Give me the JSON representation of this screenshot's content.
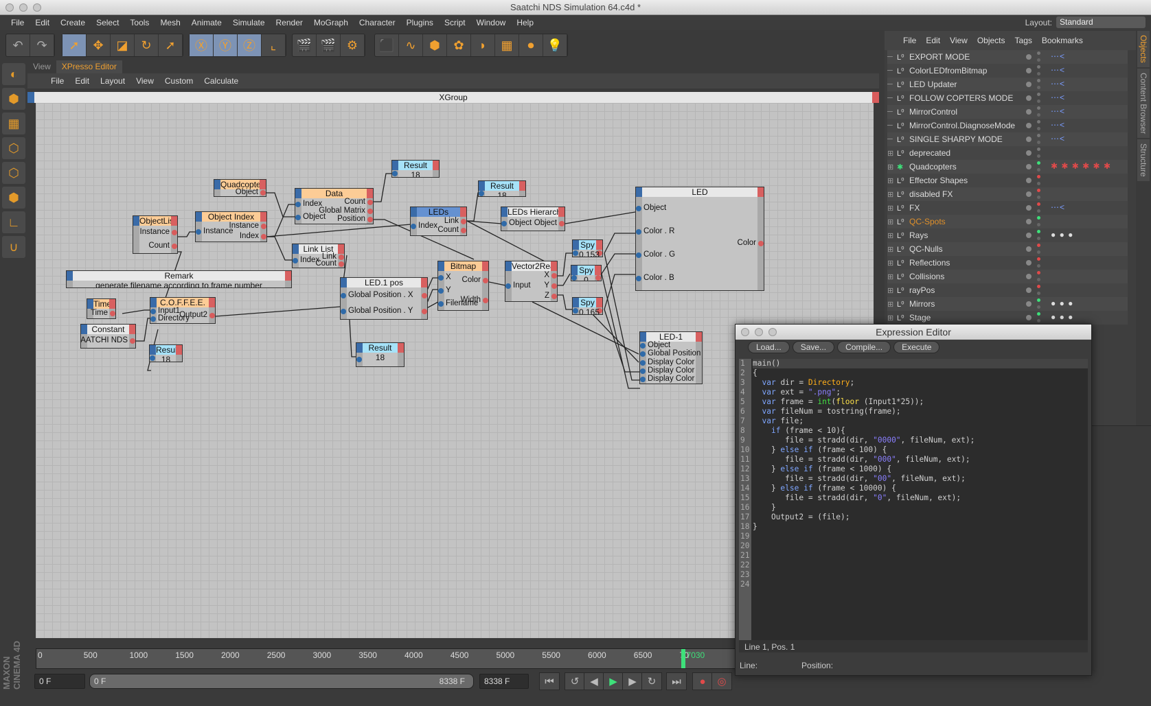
{
  "window": {
    "title": "Saatchi NDS Simulation 64.c4d *"
  },
  "menu": [
    "File",
    "Edit",
    "Create",
    "Select",
    "Tools",
    "Mesh",
    "Animate",
    "Simulate",
    "Render",
    "MoGraph",
    "Character",
    "Plugins",
    "Script",
    "Window",
    "Help"
  ],
  "layout": {
    "label": "Layout:",
    "value": "Standard"
  },
  "toolbar_icons": [
    "undo-icon",
    "redo-icon",
    "live-select-icon",
    "move-icon",
    "scale-icon",
    "rotate-icon",
    "last-tool-icon",
    "x-axis-icon",
    "y-axis-icon",
    "z-axis-icon",
    "coordinate-system-icon",
    "render-view-icon",
    "render-picture-viewer-icon",
    "render-settings-icon",
    "cube-icon",
    "spline-icon",
    "nurbs-icon",
    "array-icon",
    "deformer-icon",
    "floor-icon",
    "camera-icon",
    "light-icon"
  ],
  "xpresso": {
    "tabs": [
      "View",
      "XPresso Editor"
    ],
    "menu": [
      "File",
      "Edit",
      "Layout",
      "View",
      "Custom",
      "Calculate"
    ],
    "group_title": "XGroup",
    "nodes": [
      {
        "title": "Result",
        "style": "res",
        "inputs": [
          ""
        ],
        "outputs": [],
        "value": "18"
      },
      {
        "title": "Quadcopters",
        "style": "obj",
        "inputs": [],
        "outputs": [
          "Object"
        ]
      },
      {
        "title": "Data",
        "style": "obj",
        "inputs": [
          "Index",
          "Object"
        ],
        "outputs": [
          "Count",
          "Global Matrix",
          "Position"
        ]
      },
      {
        "title": "ObjectList",
        "style": "obj",
        "inputs": [],
        "outputs": [
          "Instance",
          "Count"
        ]
      },
      {
        "title": "Object Index",
        "style": "obj",
        "inputs": [
          "Instance"
        ],
        "outputs": [
          "Instance",
          "Index"
        ]
      },
      {
        "title": "LEDs",
        "style": "blue",
        "inputs": [
          "Index"
        ],
        "outputs": [
          "Link",
          "Count"
        ]
      },
      {
        "title": "Result",
        "style": "res",
        "inputs": [
          ""
        ],
        "outputs": [],
        "value": "18"
      },
      {
        "title": "LEDs Hierarchy",
        "style": "gen",
        "inputs": [
          "Object"
        ],
        "outputs": [
          "Object"
        ]
      },
      {
        "title": "LED",
        "style": "gen",
        "inputs": [
          "Object",
          "Color . R",
          "Color . G",
          "Color . B"
        ],
        "outputs": [
          "Color"
        ]
      },
      {
        "title": "Link List",
        "style": "gen",
        "inputs": [
          "Index"
        ],
        "outputs": [
          "Link",
          "Count"
        ]
      },
      {
        "title": "Remark",
        "style": "gen",
        "inputs": [],
        "outputs": [],
        "value": "generate filename according to frame number"
      },
      {
        "title": "LED.1 pos",
        "style": "gen",
        "inputs": [
          "Global Position . X",
          "Global Position . Y"
        ],
        "outputs": [
          "",
          ""
        ]
      },
      {
        "title": "Bitmap",
        "style": "obj",
        "inputs": [
          "X",
          "Y",
          "Filename"
        ],
        "outputs": [
          "Color",
          "Width"
        ]
      },
      {
        "title": "Vector2Real",
        "style": "gen",
        "inputs": [
          "Input"
        ],
        "outputs": [
          "X",
          "Y",
          "Z"
        ]
      },
      {
        "title": "Spy",
        "style": "res",
        "inputs": [
          ""
        ],
        "outputs": [
          ""
        ],
        "value": "0.153"
      },
      {
        "title": "Spy",
        "style": "res",
        "inputs": [
          ""
        ],
        "outputs": [
          ""
        ],
        "value": "0"
      },
      {
        "title": "Spy",
        "style": "res",
        "inputs": [
          ""
        ],
        "outputs": [
          ""
        ],
        "value": "0.165"
      },
      {
        "title": "Time",
        "style": "obj",
        "inputs": [],
        "outputs": [
          "Time"
        ]
      },
      {
        "title": "C.O.F.F.E.E.",
        "style": "obj",
        "inputs": [
          "Input1",
          "Directory"
        ],
        "outputs": [
          "Output2"
        ]
      },
      {
        "title": "Constant",
        "style": "gen",
        "inputs": [],
        "outputs": [
          "SAATCHI NDS"
        ]
      },
      {
        "title": "Result",
        "style": "res",
        "inputs": [
          ""
        ],
        "outputs": [],
        "value": "18"
      },
      {
        "title": "Result",
        "style": "res",
        "inputs": [
          ""
        ],
        "outputs": [],
        "value": "18"
      },
      {
        "title": "LED-1",
        "style": "gen",
        "inputs": [
          "Object",
          "Global Position",
          "Display Color",
          "Display Color",
          "Display Color"
        ],
        "outputs": []
      }
    ]
  },
  "object_manager": {
    "menu": [
      "File",
      "Edit",
      "View",
      "Objects",
      "Tags",
      "Bookmarks"
    ],
    "rows": [
      {
        "name": "EXPORT MODE",
        "expand": false,
        "status": "gray",
        "tags": "xpresso"
      },
      {
        "name": "ColorLEDfromBitmap",
        "expand": false,
        "status": "gray",
        "tags": "xpresso"
      },
      {
        "name": "LED Updater",
        "expand": false,
        "status": "gray",
        "tags": "xpresso"
      },
      {
        "name": "FOLLOW COPTERS MODE",
        "expand": false,
        "status": "gray",
        "tags": "xpresso"
      },
      {
        "name": "MirrorControl",
        "expand": false,
        "status": "gray",
        "tags": "xpresso"
      },
      {
        "name": "MirrorControl.DiagnoseMode",
        "expand": false,
        "status": "gray",
        "tags": "xpresso"
      },
      {
        "name": "SINGLE SHARPY MODE",
        "expand": false,
        "status": "gray",
        "tags": "xpresso"
      },
      {
        "name": "deprecated",
        "expand": true,
        "status": "gray",
        "tags": ""
      },
      {
        "name": "Quadcopters",
        "expand": true,
        "status": "green",
        "tags": "cloner"
      },
      {
        "name": "Effector Shapes",
        "expand": true,
        "status": "red",
        "tags": ""
      },
      {
        "name": "disabled FX",
        "expand": true,
        "status": "red",
        "tags": ""
      },
      {
        "name": "FX",
        "expand": true,
        "status": "red",
        "tags": "xpresso"
      },
      {
        "name": "QC-Spots",
        "expand": true,
        "status": "green",
        "tags": "",
        "highlight": "#e0902a"
      },
      {
        "name": "Rays",
        "expand": true,
        "status": "green",
        "tags": "material"
      },
      {
        "name": "QC-Nulls",
        "expand": true,
        "status": "red",
        "tags": ""
      },
      {
        "name": "Reflections",
        "expand": true,
        "status": "red",
        "tags": ""
      },
      {
        "name": "Collisions",
        "expand": true,
        "status": "red",
        "tags": ""
      },
      {
        "name": "rayPos",
        "expand": true,
        "status": "red",
        "tags": ""
      },
      {
        "name": "Mirrors",
        "expand": true,
        "status": "green",
        "tags": "material"
      },
      {
        "name": "Stage",
        "expand": true,
        "status": "green",
        "tags": "material"
      }
    ],
    "side_tabs": [
      "Objects",
      "Content Browser",
      "Structure"
    ]
  },
  "timeline": {
    "ticks": [
      "0",
      "500",
      "1000",
      "1500",
      "2000",
      "2500",
      "3000",
      "3500",
      "4000",
      "4500",
      "5000",
      "5500",
      "6000",
      "6500",
      "70"
    ],
    "current_frame": "7030",
    "range_max": 8338,
    "start_field": "0 F",
    "slider_start": "0 F",
    "slider_end": "8338 F",
    "end_field": "8338 F"
  },
  "expression_editor": {
    "title": "Expression Editor",
    "buttons": [
      "Load...",
      "Save...",
      "Compile...",
      "Execute"
    ],
    "code": [
      [
        [
          "main()",
          "txt"
        ]
      ],
      [
        [
          "{",
          "txt"
        ]
      ],
      [
        [
          "  ",
          "txt"
        ],
        [
          "var",
          "kw"
        ],
        [
          " dir = ",
          "txt"
        ],
        [
          "Directory",
          "cls"
        ],
        [
          ";",
          "txt"
        ]
      ],
      [
        [
          "  ",
          "txt"
        ],
        [
          "var",
          "kw"
        ],
        [
          " ext = ",
          "txt"
        ],
        [
          "\".png\"",
          "str"
        ],
        [
          ";",
          "txt"
        ]
      ],
      [
        [
          "  ",
          "txt"
        ],
        [
          "var",
          "kw"
        ],
        [
          " frame = ",
          "txt"
        ],
        [
          "int",
          "int"
        ],
        [
          "(",
          "txt"
        ],
        [
          "floor",
          "fn"
        ],
        [
          " (Input1*25));",
          "txt"
        ]
      ],
      [
        [
          "  ",
          "txt"
        ],
        [
          "var",
          "kw"
        ],
        [
          " fileNum = tostring(frame);",
          "txt"
        ]
      ],
      [
        [
          "  ",
          "txt"
        ],
        [
          "var",
          "kw"
        ],
        [
          " file;",
          "txt"
        ]
      ],
      [
        [
          "",
          "txt"
        ]
      ],
      [
        [
          "    ",
          "txt"
        ],
        [
          "if",
          "kw"
        ],
        [
          " (frame < 10){",
          "txt"
        ]
      ],
      [
        [
          "       file = stradd(dir, ",
          "txt"
        ],
        [
          "\"0000\"",
          "str"
        ],
        [
          ", fileNum, ext);",
          "txt"
        ]
      ],
      [
        [
          "",
          "txt"
        ]
      ],
      [
        [
          "    } ",
          "txt"
        ],
        [
          "else if",
          "kw"
        ],
        [
          " (frame < 100) {",
          "txt"
        ]
      ],
      [
        [
          "       file = stradd(dir, ",
          "txt"
        ],
        [
          "\"000\"",
          "str"
        ],
        [
          ", fileNum, ext);",
          "txt"
        ]
      ],
      [
        [
          "",
          "txt"
        ]
      ],
      [
        [
          "    } ",
          "txt"
        ],
        [
          "else if",
          "kw"
        ],
        [
          " (frame < 1000) {",
          "txt"
        ]
      ],
      [
        [
          "       file = stradd(dir, ",
          "txt"
        ],
        [
          "\"00\"",
          "str"
        ],
        [
          ", fileNum, ext);",
          "txt"
        ]
      ],
      [
        [
          "",
          "txt"
        ]
      ],
      [
        [
          "    } ",
          "txt"
        ],
        [
          "else if",
          "kw"
        ],
        [
          " (frame < 10000) {",
          "txt"
        ]
      ],
      [
        [
          "       file = stradd(dir, ",
          "txt"
        ],
        [
          "\"0\"",
          "str"
        ],
        [
          ", fileNum, ext);",
          "txt"
        ]
      ],
      [
        [
          "    }",
          "txt"
        ]
      ],
      [
        [
          "",
          "txt"
        ]
      ],
      [
        [
          "    Output2 = (file);",
          "txt"
        ]
      ],
      [
        [
          "",
          "txt"
        ]
      ],
      [
        [
          "}",
          "txt"
        ]
      ]
    ],
    "status": "Line 1, Pos. 1",
    "footer_line": "Line:",
    "footer_position": "Position:"
  },
  "brand": "MAXON CINEMA 4D",
  "colors": {
    "accent": "#f0a030",
    "port_in": "#2f6aa8",
    "port_out": "#d85c5c",
    "grid": "#c3c3c3"
  }
}
